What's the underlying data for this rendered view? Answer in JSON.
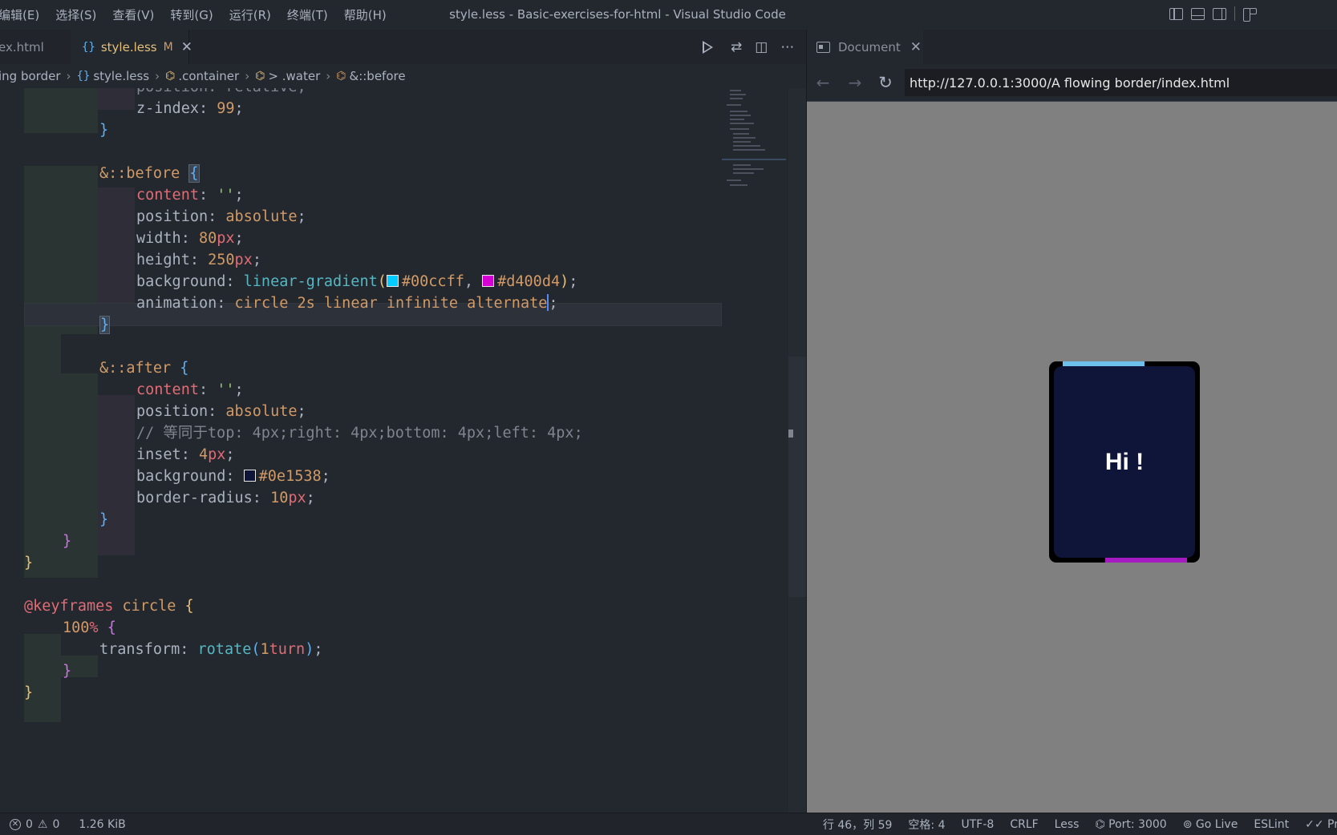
{
  "window": {
    "title": "style.less - Basic-exercises-for-html - Visual Studio Code",
    "menu": [
      "编辑(E)",
      "选择(S)",
      "查看(V)",
      "转到(G)",
      "运行(R)",
      "终端(T)",
      "帮助(H)"
    ]
  },
  "tabs": [
    {
      "label": "ex.html",
      "active": false
    },
    {
      "label": "style.less",
      "active": true,
      "badge": "M",
      "close": "✕"
    }
  ],
  "breadcrumb": [
    "ing border",
    "style.less",
    ".container",
    "> .water",
    "&::before"
  ],
  "code": {
    "lines": [
      "position: relative;",
      "z-index: 99;",
      "}",
      "&::before {",
      "content: '';",
      "position: absolute;",
      "width: 80px;",
      "height: 250px;",
      "background: linear-gradient(#00ccff, #d400d4);",
      "animation: circle 2s linear infinite alternate;",
      "}",
      "&::after {",
      "content: '';",
      "position: absolute;",
      "// 等同于top: 4px;right: 4px;bottom: 4px;left: 4px;",
      "inset: 4px;",
      "background: #0e1538;",
      "border-radius: 10px;",
      "}",
      "}",
      "}",
      "@keyframes circle {",
      "100% {",
      "transform: rotate(1turn);",
      "}",
      "}"
    ],
    "swatch_colors": {
      "cyan": "#00ccff",
      "magenta": "#d400d4",
      "navy": "#0e1538"
    }
  },
  "browser": {
    "tab_label": "Document",
    "close": "✕",
    "url": "http://127.0.0.1:3000/A flowing border/index.html",
    "card_text": "Hi !"
  },
  "status": {
    "errors": "0",
    "warnings": "0",
    "size": "1.26 KiB",
    "position": "行 46，列 59",
    "spaces": "空格: 4",
    "encoding": "UTF-8",
    "eol": "CRLF",
    "language": "Less",
    "port": "Port: 3000",
    "golive": "Go Live",
    "eslint": "ESLint",
    "prettier": "Pr"
  }
}
